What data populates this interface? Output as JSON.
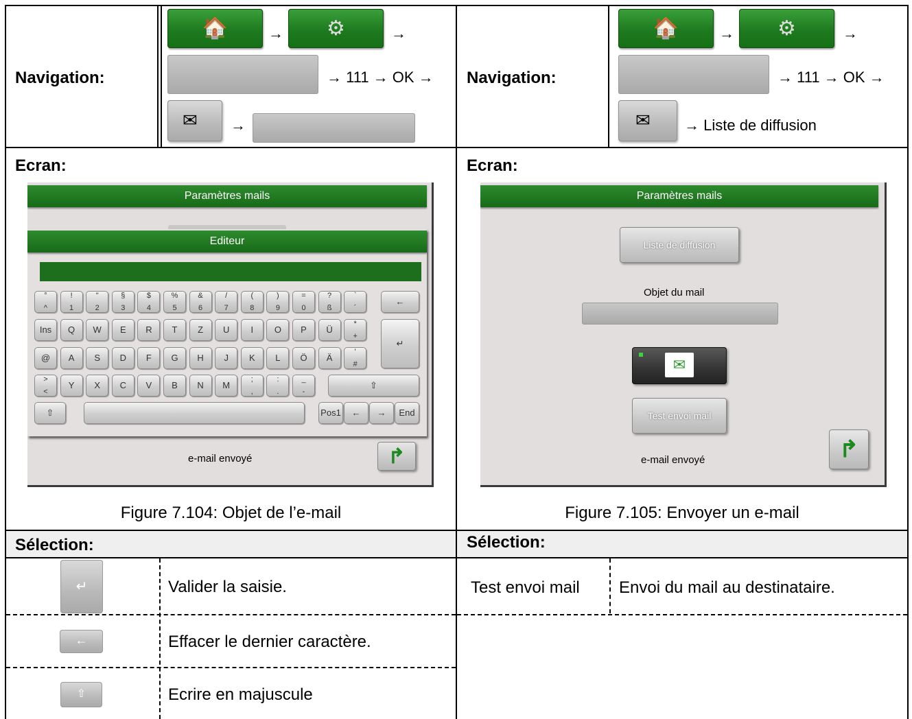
{
  "nav": {
    "label": "Navigation:",
    "arrow": "→",
    "sequence": "→ 111 → OK →",
    "right_final": "→ Liste de diffusion"
  },
  "ecran": {
    "label": "Ecran:"
  },
  "screen_left": {
    "title": "Paramètres mails",
    "editor_title": "Editeur",
    "status": "e-mail envoyé",
    "keys_row1": [
      [
        "°",
        "^"
      ],
      [
        "!",
        "1"
      ],
      [
        "\"",
        "2"
      ],
      [
        "§",
        "3"
      ],
      [
        "$",
        "4"
      ],
      [
        "%",
        "5"
      ],
      [
        "&",
        "6"
      ],
      [
        "/",
        "7"
      ],
      [
        "(",
        "8"
      ],
      [
        ")",
        "9"
      ],
      [
        "=",
        "0"
      ],
      [
        "?",
        "ß"
      ],
      [
        "`",
        "´"
      ]
    ],
    "keys_row2": [
      "Ins",
      "Q",
      "W",
      "E",
      "R",
      "T",
      "Z",
      "U",
      "I",
      "O",
      "P",
      "Ü"
    ],
    "keys_row2_extra": [
      "*",
      "+"
    ],
    "keys_row3": [
      "@",
      "A",
      "S",
      "D",
      "F",
      "G",
      "H",
      "J",
      "K",
      "L",
      "Ö",
      "Ä"
    ],
    "keys_row3_extra": [
      "'",
      "#"
    ],
    "keys_row4": [
      [
        ">",
        "<"
      ],
      [
        "",
        "Y"
      ],
      [
        "",
        "X"
      ],
      [
        "",
        "C"
      ],
      [
        "",
        "V"
      ],
      [
        "",
        "B"
      ],
      [
        "",
        "N"
      ],
      [
        "",
        "M"
      ],
      [
        ";",
        ","
      ],
      [
        ":",
        "."
      ],
      [
        "_",
        "-"
      ]
    ],
    "backspace_icon": "←",
    "enter_icon": "↵",
    "shift_icon": "⇧",
    "pos1": "Pos1",
    "left_arrow": "←",
    "right_arrow": "→",
    "end": "End"
  },
  "screen_right": {
    "title": "Paramètres mails",
    "distribution_button": "Liste de diffusion",
    "subject_label": "Objet du mail",
    "test_button": "Test envoi mail",
    "status": "e-mail envoyé"
  },
  "captions": {
    "left": "Figure 7.104: Objet de l’e-mail",
    "right": "Figure 7.105: Envoyer un e-mail"
  },
  "selection": {
    "label": "Sélection:",
    "left_rows": [
      {
        "icon": "enter-icon",
        "text": "Valider la saisie."
      },
      {
        "icon": "backspace-icon",
        "text": "Effacer le dernier caractère."
      },
      {
        "icon": "shift-icon",
        "text": "Ecrire en majuscule"
      }
    ],
    "right_rows": [
      {
        "term": "Test envoi mail",
        "text": "Envoi du mail au destinataire."
      }
    ]
  },
  "colors": {
    "green": "#1e7a1e",
    "screen_bg": "#e1dedd"
  }
}
